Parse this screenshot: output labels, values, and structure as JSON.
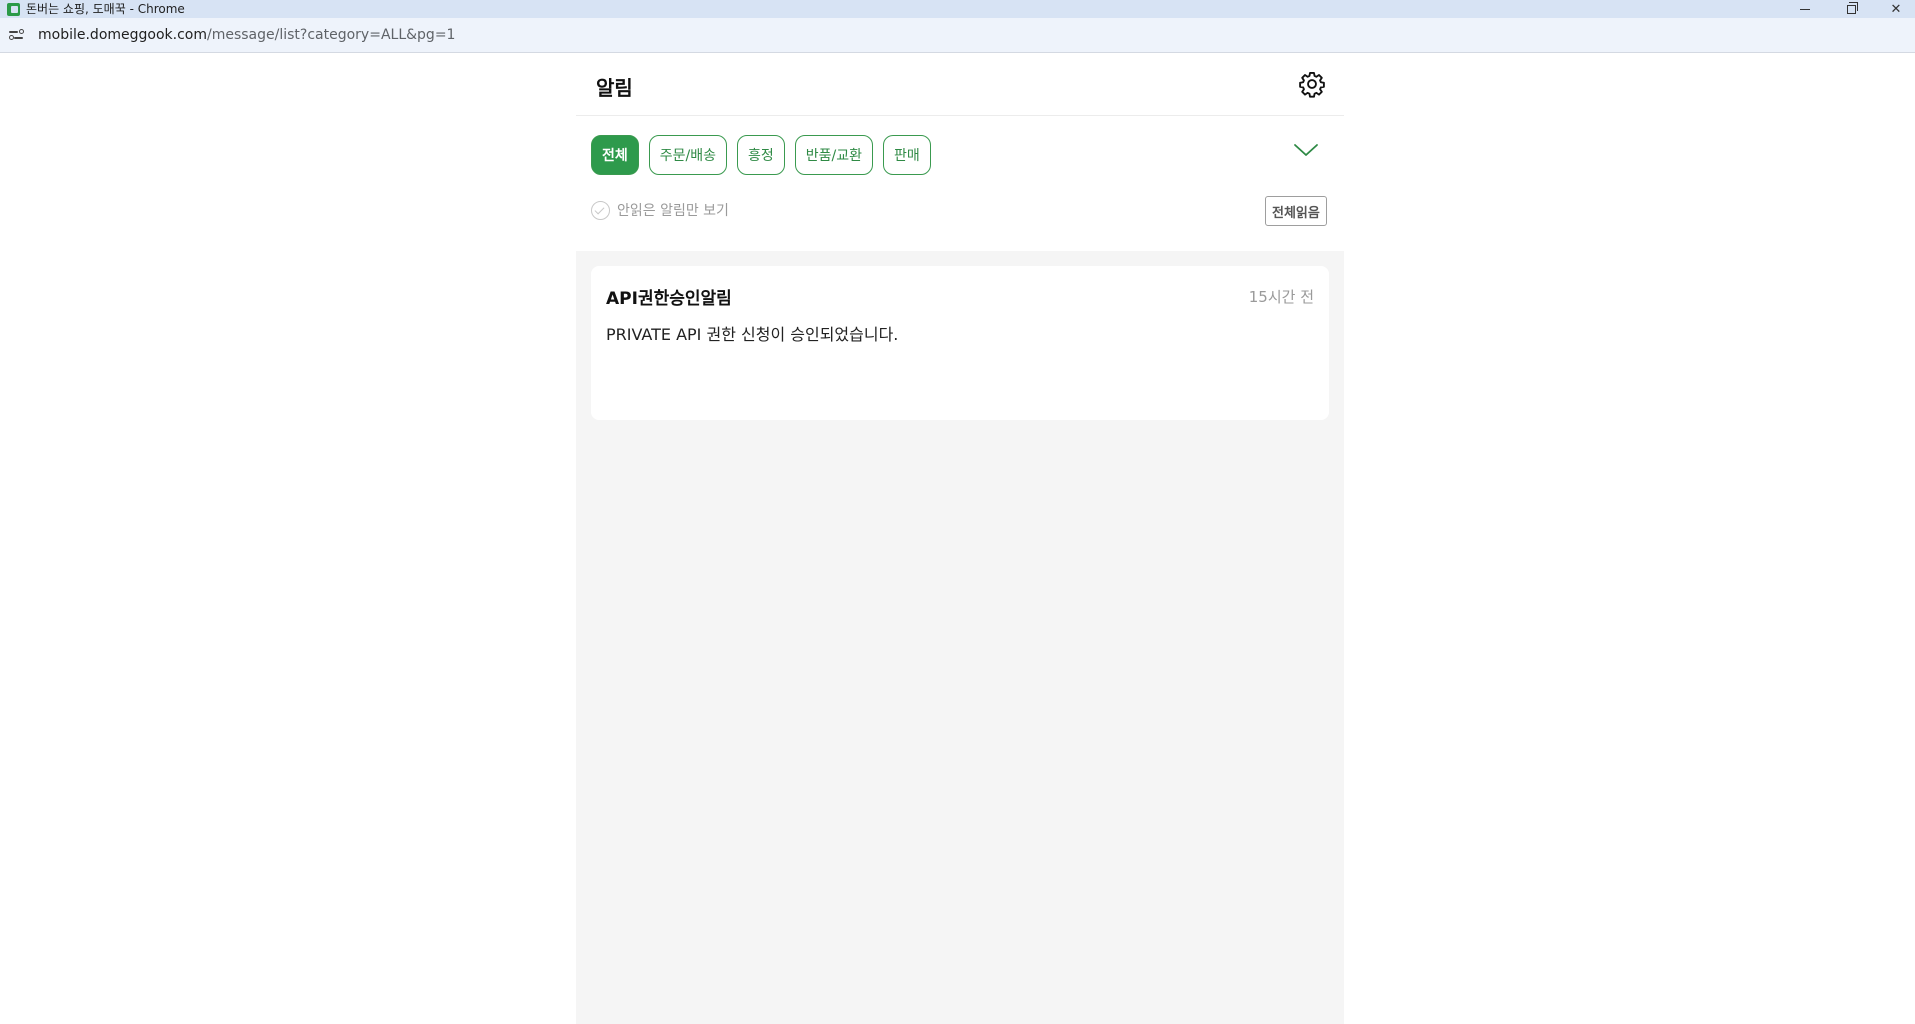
{
  "browser": {
    "window_title": "돈버는 쇼핑, 도매꾹 - Chrome",
    "url_host": "mobile.domeggook.com",
    "url_path": "/message/list?category=ALL&pg=1"
  },
  "header": {
    "title": "알림",
    "settings_icon": "gear-icon"
  },
  "filters": {
    "chips": [
      {
        "label": "전체",
        "active": true
      },
      {
        "label": "주문/배송",
        "active": false
      },
      {
        "label": "흥정",
        "active": false
      },
      {
        "label": "반품/교환",
        "active": false
      },
      {
        "label": "판매",
        "active": false
      }
    ],
    "expand_icon": "chevron-down-icon",
    "unread_only_label": "안읽은 알림만 보기",
    "read_all_label": "전체읽음"
  },
  "notifications": [
    {
      "title": "API권한승인알림",
      "time": "15시간 전",
      "body": "PRIVATE API 권한 신청이 승인되었습니다."
    }
  ],
  "colors": {
    "accent": "#2e9a4c",
    "background": "#f5f5f5"
  }
}
